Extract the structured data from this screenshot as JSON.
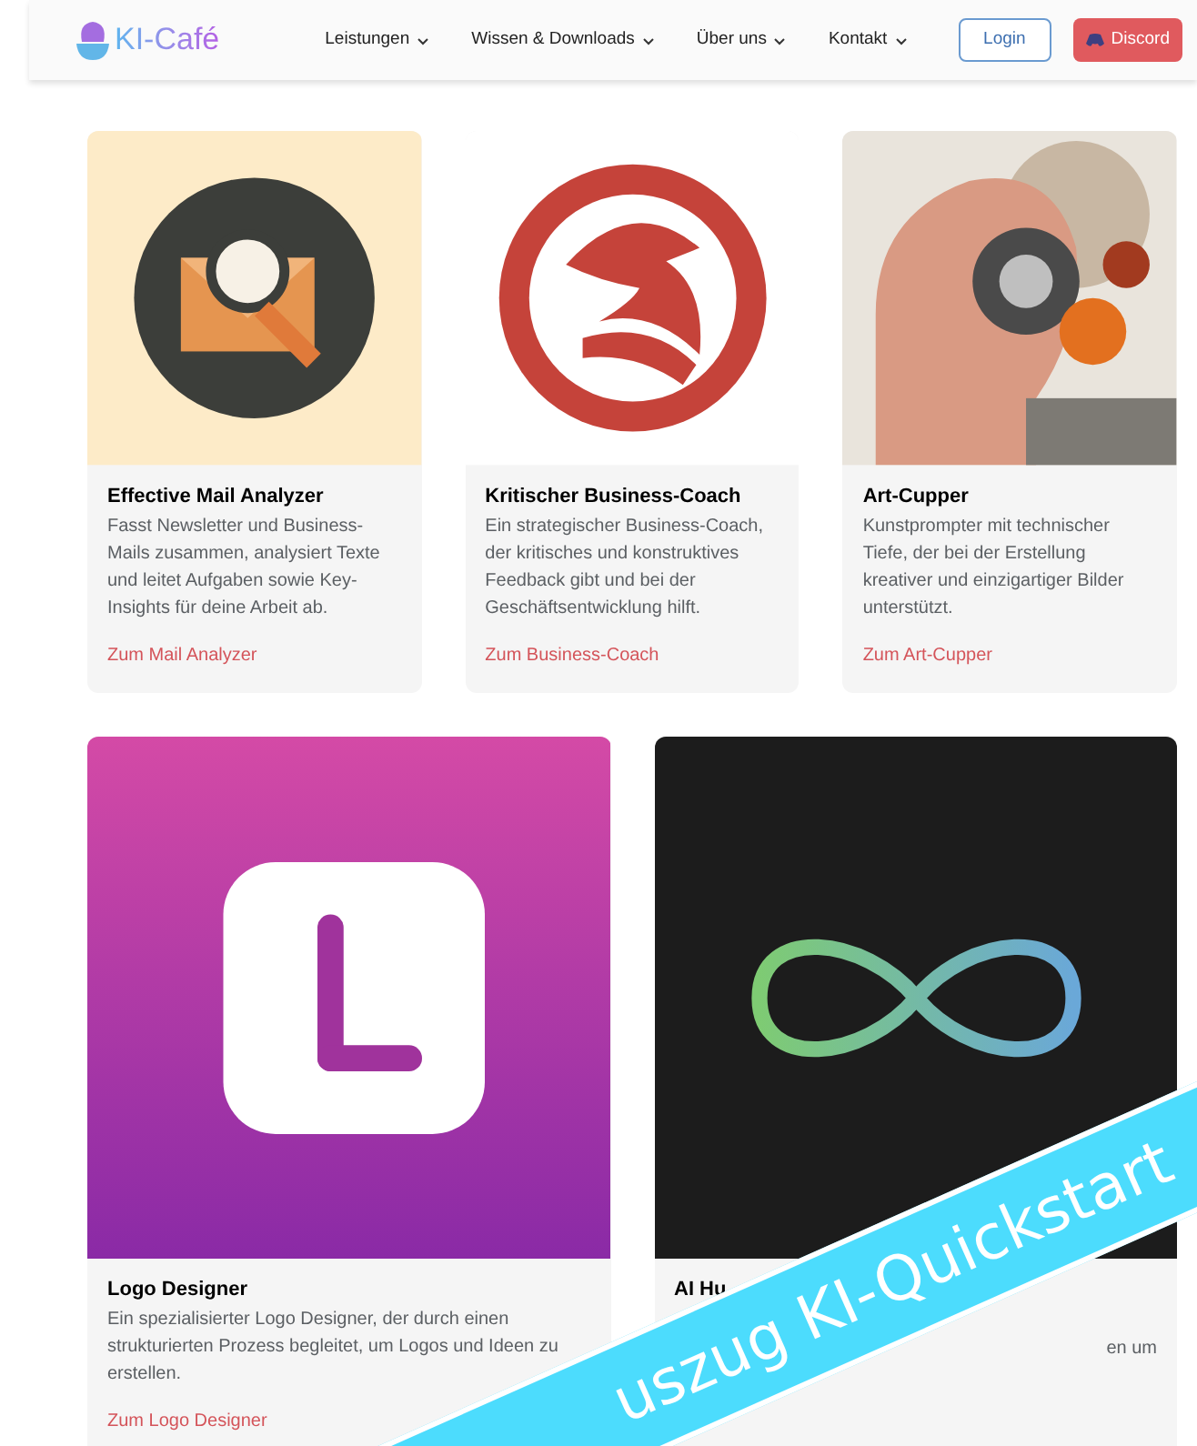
{
  "header": {
    "logo": "KI-Café",
    "nav": [
      {
        "label": "Leistungen"
      },
      {
        "label": "Wissen & Downloads"
      },
      {
        "label": "Über uns"
      },
      {
        "label": "Kontakt"
      }
    ],
    "login": "Login",
    "discord": "Discord"
  },
  "rows": [
    {
      "cards": [
        {
          "title": "Effective Mail Analyzer",
          "description": "Fasst Newsletter und Business-Mails zusammen, analysiert Texte und leitet Aufgaben sowie Key-Insights für deine Arbeit ab.",
          "link": "Zum Mail Analyzer"
        },
        {
          "title": "Kritischer Business-Coach",
          "description": "Ein strategischer Business-Coach, der kritisches und konstruktives Feedback gibt und bei der Geschäftsentwicklung hilft.",
          "link": "Zum Business-Coach"
        },
        {
          "title": "Art-Cupper",
          "description": "Kunstprompter mit technischer Tiefe, der bei der Erstellung kreativer und einzigartiger Bilder unterstützt.",
          "link": "Zum Art-Cupper"
        }
      ]
    },
    {
      "cards": [
        {
          "title": "Logo Designer",
          "description": "Ein spezialisierter Logo Designer, der durch einen strukturierten Prozess begleitet, um Logos und Ideen zu erstellen.",
          "link": "Zum Logo Designer"
        },
        {
          "title": "AI Hu",
          "description": "en um"
        }
      ]
    }
  ],
  "banner": {
    "text": "uszug KI-Quickstart"
  }
}
